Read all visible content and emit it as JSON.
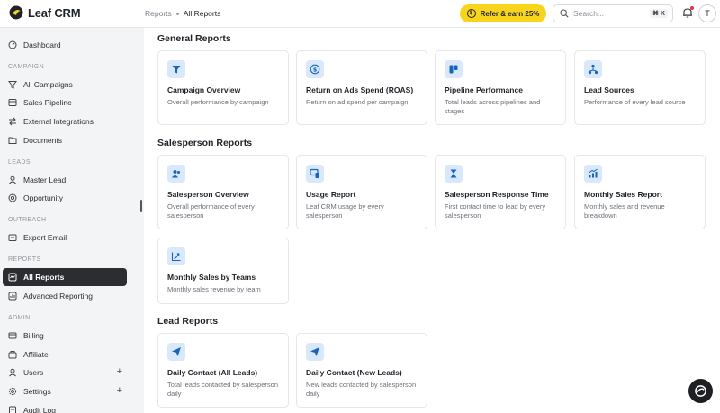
{
  "header": {
    "brand": "Leaf CRM",
    "breadcrumb": [
      "Reports",
      "All Reports"
    ],
    "refer_label": "Refer & earn 25%",
    "search_placeholder": "Search...",
    "search_shortcut": "⌘ K",
    "avatar_initial": "T"
  },
  "sidebar": {
    "dashboard": "Dashboard",
    "sections": {
      "campaign": "CAMPAIGN",
      "leads": "LEADS",
      "outreach": "OUTREACH",
      "reports": "REPORTS",
      "admin": "ADMIN"
    },
    "items": {
      "all_campaigns": "All Campaigns",
      "sales_pipeline": "Sales Pipeline",
      "external_integrations": "External Integrations",
      "documents": "Documents",
      "master_lead": "Master Lead",
      "opportunity": "Opportunity",
      "export_email": "Export Email",
      "all_reports": "All Reports",
      "advanced_reporting": "Advanced Reporting",
      "billing": "Billing",
      "affiliate": "Affiliate",
      "users": "Users",
      "settings": "Settings",
      "audit_log": "Audit Log"
    },
    "plus": "+"
  },
  "general": {
    "title": "General Reports",
    "cards": [
      {
        "title": "Campaign Overview",
        "desc": "Overall performance by campaign",
        "icon": "funnel-icon"
      },
      {
        "title": "Return on Ads Spend (ROAS)",
        "desc": "Return on ad spend per campaign",
        "icon": "dollar-cycle-icon"
      },
      {
        "title": "Pipeline Performance",
        "desc": "Total leads across pipelines and stages",
        "icon": "kanban-icon"
      },
      {
        "title": "Lead Sources",
        "desc": "Performance of every lead source",
        "icon": "sources-icon"
      }
    ]
  },
  "salesperson": {
    "title": "Salesperson Reports",
    "cards": [
      {
        "title": "Salesperson Overview",
        "desc": "Overall performance of every salesperson",
        "icon": "people-icon"
      },
      {
        "title": "Usage Report",
        "desc": "Leaf CRM usage by every salesperson",
        "icon": "devices-icon"
      },
      {
        "title": "Salesperson Response Time",
        "desc": "First contact time to lead by every salesperson",
        "icon": "hourglass-icon"
      },
      {
        "title": "Monthly Sales Report",
        "desc": "Monthly sales and revenue breakdown",
        "icon": "bar-trend-icon"
      },
      {
        "title": "Monthly Sales by Teams",
        "desc": "Monthly sales revenue by team",
        "icon": "trend-up-icon"
      }
    ]
  },
  "lead": {
    "title": "Lead Reports",
    "cards": [
      {
        "title": "Daily Contact (All Leads)",
        "desc": "Total leads contacted by salesperson daily",
        "icon": "send-icon"
      },
      {
        "title": "Daily Contact (New Leads)",
        "desc": "New leads contacted by salesperson daily",
        "icon": "send-icon"
      }
    ]
  },
  "colors": {
    "accent_icon": "#1565c0",
    "icon_bg": "#d9e8fb",
    "refer_bg": "#f8d41c",
    "active_nav": "#2b2d31"
  }
}
